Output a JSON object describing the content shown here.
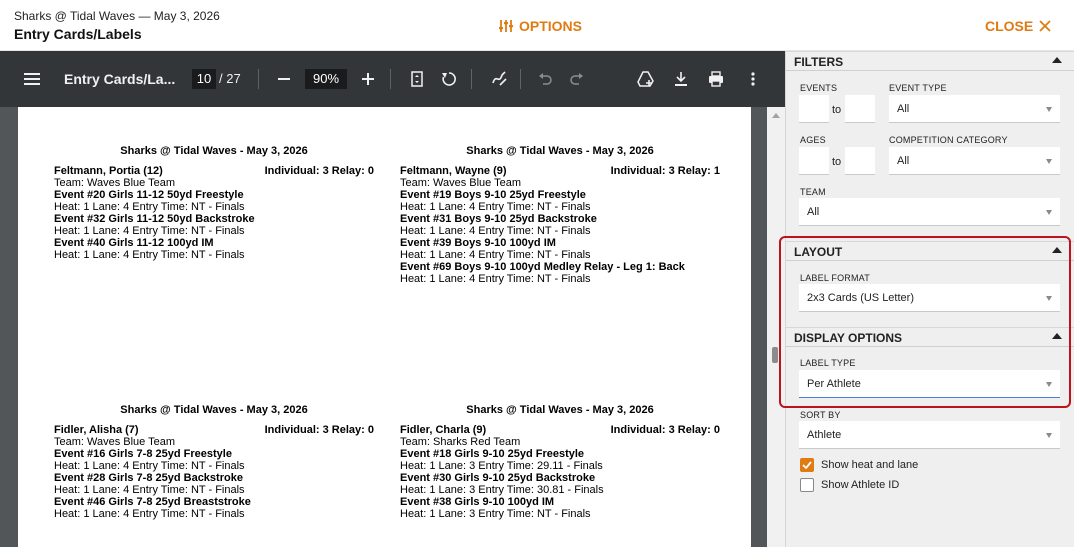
{
  "header": {
    "subtitle": "Sharks @ Tidal Waves — May 3, 2026",
    "title": "Entry Cards/Labels",
    "options_label": "OPTIONS",
    "close_label": "CLOSE"
  },
  "viewer": {
    "doc_title": "Entry Cards/La...",
    "page_current": "10",
    "page_total": "/ 27",
    "zoom": "90%",
    "icons": [
      "menu-icon",
      "zoom-out-icon",
      "zoom-in-icon",
      "fit-page-icon",
      "rotate-icon",
      "draw-icon",
      "undo-icon",
      "redo-icon",
      "add-to-drive-icon",
      "download-icon",
      "print-icon",
      "more-icon"
    ]
  },
  "cards": [
    {
      "title": "Sharks @ Tidal Waves - May 3, 2026",
      "athlete": "Feltmann, Portia (12)",
      "counts": "Individual: 3 Relay: 0",
      "team": "Team: Waves Blue Team",
      "lines": [
        {
          "bold": true,
          "text": "Event #20 Girls 11-12 50yd Freestyle"
        },
        {
          "bold": false,
          "text": "Heat: 1   Lane: 4   Entry Time: NT - Finals"
        },
        {
          "bold": true,
          "text": "Event #32 Girls 11-12 50yd Backstroke"
        },
        {
          "bold": false,
          "text": "Heat: 1   Lane: 4   Entry Time: NT - Finals"
        },
        {
          "bold": true,
          "text": "Event #40 Girls 11-12 100yd IM"
        },
        {
          "bold": false,
          "text": "Heat: 1   Lane: 4   Entry Time: NT - Finals"
        }
      ]
    },
    {
      "title": "Sharks @ Tidal Waves - May 3, 2026",
      "athlete": "Feltmann, Wayne (9)",
      "counts": "Individual: 3 Relay: 1",
      "team": "Team: Waves Blue Team",
      "lines": [
        {
          "bold": true,
          "text": "Event #19 Boys 9-10 25yd Freestyle"
        },
        {
          "bold": false,
          "text": "Heat: 1   Lane: 4   Entry Time: NT - Finals"
        },
        {
          "bold": true,
          "text": "Event #31 Boys 9-10 25yd Backstroke"
        },
        {
          "bold": false,
          "text": "Heat: 1   Lane: 4   Entry Time: NT - Finals"
        },
        {
          "bold": true,
          "text": "Event #39 Boys 9-10 100yd IM"
        },
        {
          "bold": false,
          "text": "Heat: 1   Lane: 4   Entry Time: NT - Finals"
        },
        {
          "bold": true,
          "text": "Event #69 Boys 9-10 100yd Medley Relay - Leg 1: Back"
        },
        {
          "bold": false,
          "text": "Heat: 1   Lane: 4   Entry Time: NT - Finals"
        }
      ]
    },
    {
      "title": "Sharks @ Tidal Waves - May 3, 2026",
      "athlete": "Fidler, Alisha (7)",
      "counts": "Individual: 3 Relay: 0",
      "team": "Team: Waves Blue Team",
      "lines": [
        {
          "bold": true,
          "text": "Event #16 Girls 7-8 25yd Freestyle"
        },
        {
          "bold": false,
          "text": "Heat: 1   Lane: 4   Entry Time: NT - Finals"
        },
        {
          "bold": true,
          "text": "Event #28 Girls 7-8 25yd Backstroke"
        },
        {
          "bold": false,
          "text": "Heat: 1   Lane: 4   Entry Time: NT - Finals"
        },
        {
          "bold": true,
          "text": "Event #46 Girls 7-8 25yd Breaststroke"
        },
        {
          "bold": false,
          "text": "Heat: 1   Lane: 4   Entry Time: NT - Finals"
        }
      ]
    },
    {
      "title": "Sharks @ Tidal Waves - May 3, 2026",
      "athlete": "Fidler, Charla (9)",
      "counts": "Individual: 3 Relay: 0",
      "team": "Team: Sharks Red Team",
      "lines": [
        {
          "bold": true,
          "text": "Event #18 Girls 9-10 25yd Freestyle"
        },
        {
          "bold": false,
          "text": "Heat: 1   Lane: 3   Entry Time: 29.11 - Finals"
        },
        {
          "bold": true,
          "text": "Event #30 Girls 9-10 25yd Backstroke"
        },
        {
          "bold": false,
          "text": "Heat: 1   Lane: 3   Entry Time: 30.81 - Finals"
        },
        {
          "bold": true,
          "text": "Event #38 Girls 9-10 100yd IM"
        },
        {
          "bold": false,
          "text": "Heat: 1   Lane: 3   Entry Time: NT - Finals"
        }
      ]
    }
  ],
  "panel": {
    "filters": {
      "heading": "FILTERS",
      "events_label": "EVENTS",
      "to_label": "to",
      "event_type_label": "EVENT TYPE",
      "event_type_value": "All",
      "ages_label": "AGES",
      "competition_category_label": "COMPETITION CATEGORY",
      "competition_category_value": "All",
      "team_label": "TEAM",
      "team_value": "All"
    },
    "layout": {
      "heading": "LAYOUT",
      "label_format_label": "LABEL FORMAT",
      "label_format_value": "2x3 Cards (US Letter)"
    },
    "display": {
      "heading": "DISPLAY OPTIONS",
      "label_type_label": "LABEL TYPE",
      "label_type_value": "Per Athlete",
      "sort_by_label": "SORT BY",
      "sort_by_value": "Athlete",
      "show_heat_lane_label": "Show heat and lane",
      "show_heat_lane_checked": true,
      "show_athlete_id_label": "Show Athlete ID",
      "show_athlete_id_checked": false
    }
  },
  "colors": {
    "accent": "#e07b13",
    "highlight": "#c0111f",
    "toolbar": "#323639"
  }
}
